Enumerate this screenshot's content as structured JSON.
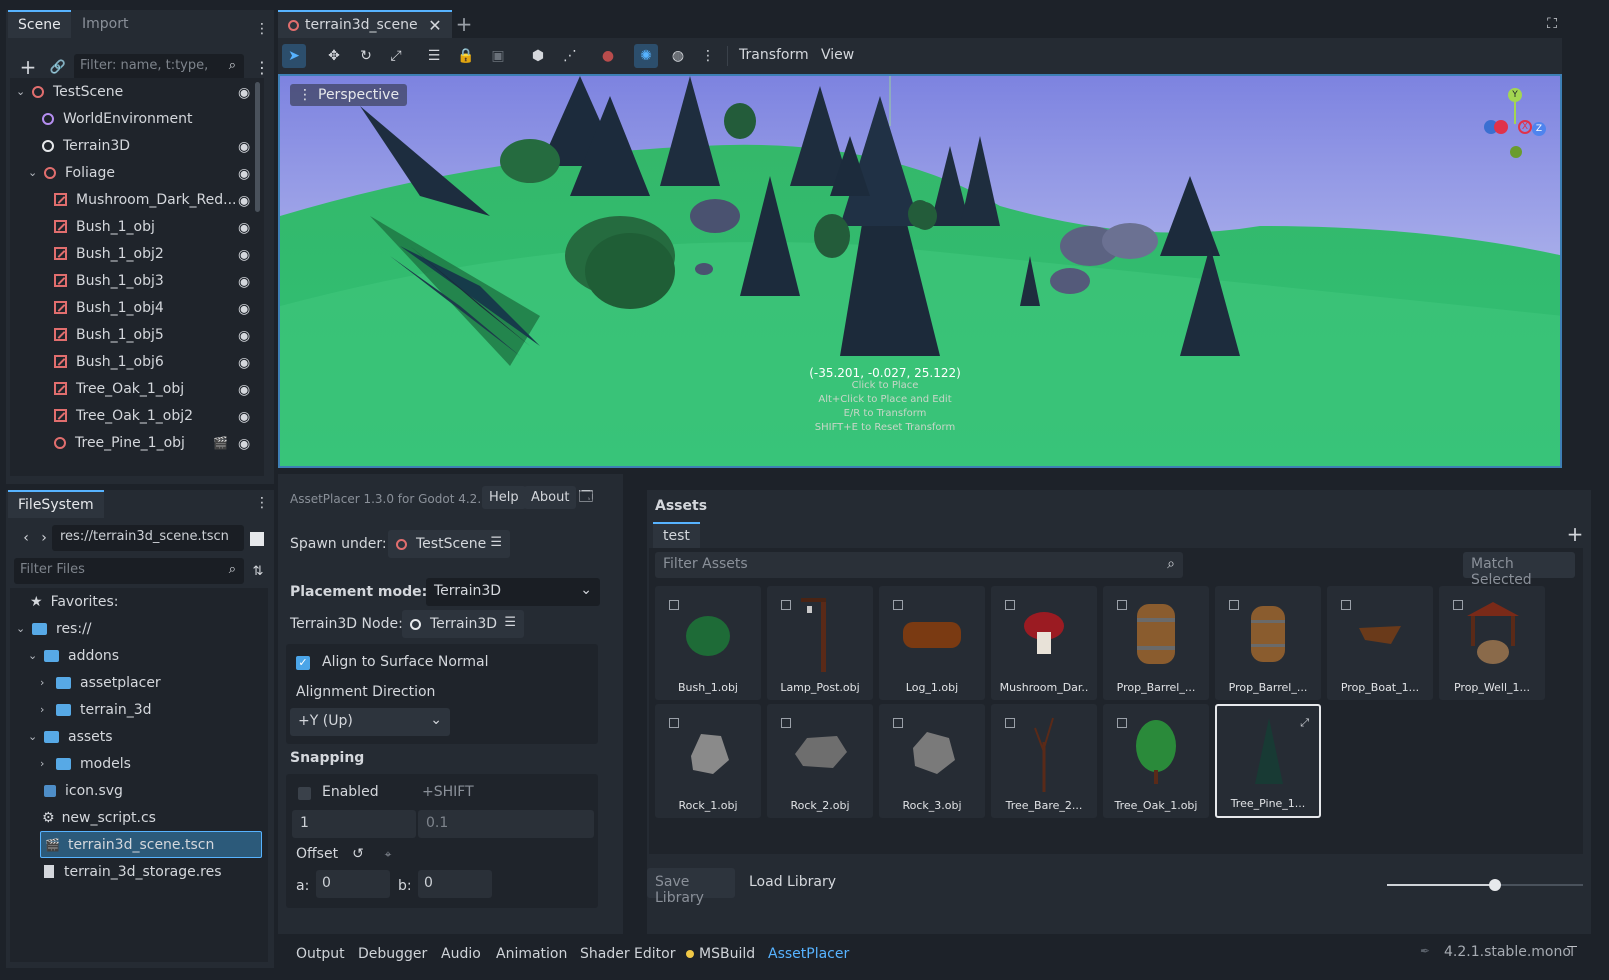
{
  "scene_dock": {
    "tabs": [
      "Scene",
      "Import"
    ],
    "filter_placeholder": "Filter: name, t:type,",
    "tree": [
      {
        "label": "TestScene",
        "depth": 0
      },
      {
        "label": "WorldEnvironment",
        "depth": 1
      },
      {
        "label": "Terrain3D",
        "depth": 1
      },
      {
        "label": "Foliage",
        "depth": 1
      },
      {
        "label": "Mushroom_Dark_Red...",
        "depth": 2
      },
      {
        "label": "Bush_1_obj",
        "depth": 2
      },
      {
        "label": "Bush_1_obj2",
        "depth": 2
      },
      {
        "label": "Bush_1_obj3",
        "depth": 2
      },
      {
        "label": "Bush_1_obj4",
        "depth": 2
      },
      {
        "label": "Bush_1_obj5",
        "depth": 2
      },
      {
        "label": "Bush_1_obj6",
        "depth": 2
      },
      {
        "label": "Tree_Oak_1_obj",
        "depth": 2
      },
      {
        "label": "Tree_Oak_1_obj2",
        "depth": 2
      },
      {
        "label": "Tree_Pine_1_obj",
        "depth": 2
      }
    ]
  },
  "filesystem": {
    "tab": "FileSystem",
    "path": "res://terrain3d_scene.tscn",
    "filter_placeholder": "Filter Files",
    "items": [
      {
        "label": "Favorites:"
      },
      {
        "label": "res://"
      },
      {
        "label": "addons"
      },
      {
        "label": "assetplacer"
      },
      {
        "label": "terrain_3d"
      },
      {
        "label": "assets"
      },
      {
        "label": "models"
      },
      {
        "label": "icon.svg"
      },
      {
        "label": "new_script.cs"
      },
      {
        "label": "terrain3d_scene.tscn"
      },
      {
        "label": "terrain_3d_storage.res"
      }
    ]
  },
  "editor": {
    "tab": "terrain3d_scene",
    "menu_transform": "Transform",
    "menu_view": "View",
    "viewport_label": "Perspective",
    "coords": "(-35.201, -0.027, 25.122)",
    "hints": [
      "Click to Place",
      "Alt+Click to Place and Edit",
      "E/R to Transform",
      "SHIFT+E to Reset Transform"
    ],
    "gizmo": {
      "y": "Y",
      "x": "X",
      "z": "Z"
    }
  },
  "assetplacer": {
    "version": "AssetPlacer 1.3.0 for Godot 4.2.",
    "help": "Help",
    "about": "About",
    "spawn_under_label": "Spawn under:",
    "spawn_under_value": "TestScene",
    "placement_mode_label": "Placement mode:",
    "placement_mode_value": "Terrain3D",
    "terrain_node_label": "Terrain3D Node:",
    "terrain_node_value": "Terrain3D",
    "align_label": "Align to Surface Normal",
    "align_dir_label": "Alignment Direction",
    "align_dir_value": "+Y (Up)",
    "snapping_title": "Snapping",
    "enabled_label": "Enabled",
    "shift_label": "+SHIFT",
    "snap_value": "1",
    "snap_shift_value": "0.1",
    "offset_label": "Offset",
    "a_label": "a:",
    "a_value": "0",
    "b_label": "b:",
    "b_value": "0"
  },
  "assets": {
    "title": "Assets",
    "library_tab": "test",
    "filter_placeholder": "Filter Assets",
    "match_selected": "Match Selected",
    "items": [
      "Bush_1.obj",
      "Lamp_Post.obj",
      "Log_1.obj",
      "Mushroom_Dar..",
      "Prop_Barrel_...",
      "Prop_Barrel_...",
      "Prop_Boat_1...",
      "Prop_Well_1...",
      "Rock_1.obj",
      "Rock_2.obj",
      "Rock_3.obj",
      "Tree_Bare_2...",
      "Tree_Oak_1.obj",
      "Tree_Pine_1..."
    ],
    "save_library": "Save Library",
    "load_library": "Load Library",
    "thumb_size": 0.55
  },
  "bottom": {
    "tabs": [
      "Output",
      "Debugger",
      "Audio",
      "Animation",
      "Shader Editor",
      "MSBuild",
      "AssetPlacer"
    ],
    "version": "4.2.1.stable.mono"
  },
  "colors": {
    "accent": "#57b3ff",
    "node_red": "#e16e6e",
    "folder_blue": "#57a9e6",
    "selection": "#2c5a7a"
  }
}
